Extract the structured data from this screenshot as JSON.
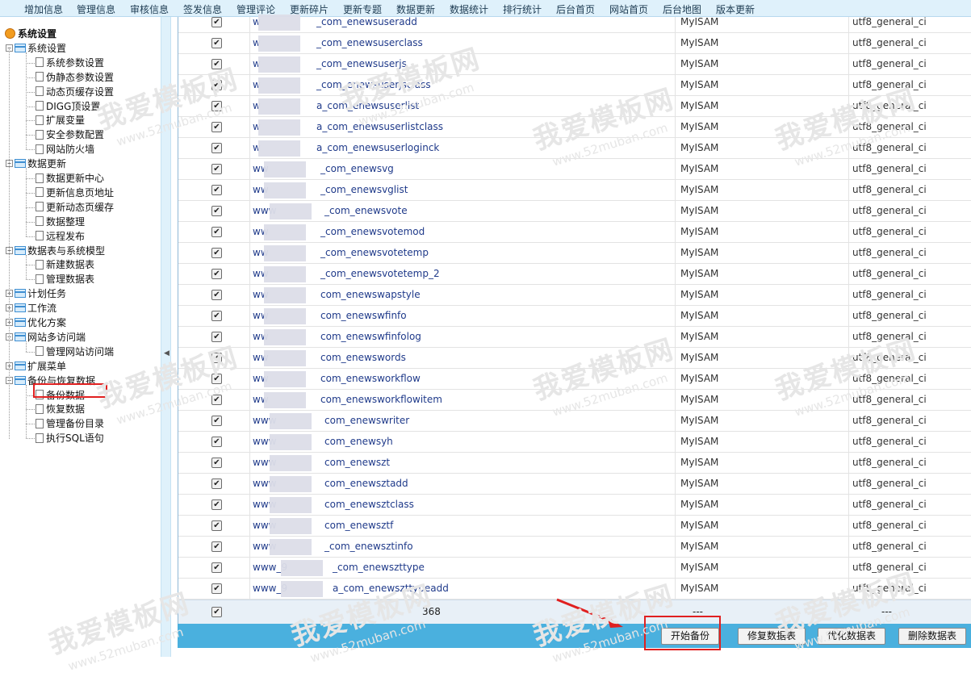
{
  "top_nav": [
    "增加信息",
    "管理信息",
    "审核信息",
    "签发信息",
    "管理评论",
    "更新碎片",
    "更新专题",
    "数据更新",
    "数据统计",
    "排行统计",
    "后台首页",
    "网站首页",
    "后台地图",
    "版本更新"
  ],
  "sidebar": {
    "root": "系统设置",
    "groups": [
      {
        "label": "系统设置",
        "expanded": true,
        "items": [
          "系统参数设置",
          "伪静态参数设置",
          "动态页缓存设置",
          "DIGG顶设置",
          "扩展变量",
          "安全参数配置",
          "网站防火墙"
        ]
      },
      {
        "label": "数据更新",
        "expanded": true,
        "items": [
          "数据更新中心",
          "更新信息页地址",
          "更新动态页缓存",
          "数据整理",
          "远程发布"
        ]
      },
      {
        "label": "数据表与系统模型",
        "expanded": true,
        "items": [
          "新建数据表",
          "管理数据表"
        ]
      },
      {
        "label": "计划任务",
        "expanded": false,
        "items": []
      },
      {
        "label": "工作流",
        "expanded": false,
        "items": []
      },
      {
        "label": "优化方案",
        "expanded": false,
        "items": []
      },
      {
        "label": "网站多访问端",
        "expanded": true,
        "items": [
          "管理网站访问端"
        ]
      },
      {
        "label": "扩展菜单",
        "expanded": false,
        "items": []
      },
      {
        "label": "备份与恢复数据",
        "expanded": true,
        "items": [
          "备份数据",
          "恢复数据",
          "管理备份目录",
          "执行SQL语句"
        ]
      }
    ],
    "selected_item": "备份数据"
  },
  "table": {
    "checked_mark": "✔",
    "rows": [
      {
        "name": "_com_enewsuseradd",
        "prefix": "w",
        "engine": "MyISAM",
        "collation": "utf8_general_ci"
      },
      {
        "name": "_com_enewsuserclass",
        "prefix": "w",
        "engine": "MyISAM",
        "collation": "utf8_general_ci"
      },
      {
        "name": "_com_enewsuserjs",
        "prefix": "w",
        "engine": "MyISAM",
        "collation": "utf8_general_ci"
      },
      {
        "name": "_com_enewsuserjsclass",
        "prefix": "w",
        "engine": "MyISAM",
        "collation": "utf8_general_ci"
      },
      {
        "name": "a_com_enewsuserlist",
        "prefix": "w",
        "engine": "MyISAM",
        "collation": "utf8_general_ci"
      },
      {
        "name": "a_com_enewsuserlistclass",
        "prefix": "w",
        "engine": "MyISAM",
        "collation": "utf8_general_ci"
      },
      {
        "name": "a_com_enewsuserloginck",
        "prefix": "w",
        "engine": "MyISAM",
        "collation": "utf8_general_ci"
      },
      {
        "name": "_com_enewsvg",
        "prefix": "ww",
        "engine": "MyISAM",
        "collation": "utf8_general_ci"
      },
      {
        "name": "_com_enewsvglist",
        "prefix": "ww",
        "engine": "MyISAM",
        "collation": "utf8_general_ci"
      },
      {
        "name": "_com_enewsvote",
        "prefix": "www",
        "engine": "MyISAM",
        "collation": "utf8_general_ci"
      },
      {
        "name": "_com_enewsvotemod",
        "prefix": "ww",
        "engine": "MyISAM",
        "collation": "utf8_general_ci"
      },
      {
        "name": "_com_enewsvotetemp",
        "prefix": "ww",
        "engine": "MyISAM",
        "collation": "utf8_general_ci"
      },
      {
        "name": "_com_enewsvotetemp_2",
        "prefix": "ww",
        "engine": "MyISAM",
        "collation": "utf8_general_ci"
      },
      {
        "name": "com_enewswapstyle",
        "prefix": "ww",
        "engine": "MyISAM",
        "collation": "utf8_general_ci"
      },
      {
        "name": "com_enewswfinfo",
        "prefix": "ww",
        "engine": "MyISAM",
        "collation": "utf8_general_ci"
      },
      {
        "name": "com_enewswfinfolog",
        "prefix": "ww",
        "engine": "MyISAM",
        "collation": "utf8_general_ci"
      },
      {
        "name": "com_enewswords",
        "prefix": "ww",
        "engine": "MyISAM",
        "collation": "utf8_general_ci"
      },
      {
        "name": "com_enewsworkflow",
        "prefix": "ww",
        "engine": "MyISAM",
        "collation": "utf8_general_ci"
      },
      {
        "name": "com_enewsworkflowitem",
        "prefix": "ww",
        "engine": "MyISAM",
        "collation": "utf8_general_ci"
      },
      {
        "name": "com_enewswriter",
        "prefix": "www",
        "engine": "MyISAM",
        "collation": "utf8_general_ci"
      },
      {
        "name": "com_enewsyh",
        "prefix": "www",
        "engine": "MyISAM",
        "collation": "utf8_general_ci"
      },
      {
        "name": "com_enewszt",
        "prefix": "www",
        "engine": "MyISAM",
        "collation": "utf8_general_ci"
      },
      {
        "name": "com_enewsztadd",
        "prefix": "www",
        "engine": "MyISAM",
        "collation": "utf8_general_ci"
      },
      {
        "name": "com_enewsztclass",
        "prefix": "www",
        "engine": "MyISAM",
        "collation": "utf8_general_ci"
      },
      {
        "name": "com_enewsztf",
        "prefix": "www",
        "engine": "MyISAM",
        "collation": "utf8_general_ci"
      },
      {
        "name": "_com_enewsztinfo",
        "prefix": "www",
        "engine": "MyISAM",
        "collation": "utf8_general_ci"
      },
      {
        "name": "_com_enewszttype",
        "prefix": "www_9",
        "engine": "MyISAM",
        "collation": "utf8_general_ci"
      },
      {
        "name": "a_com_enewszttypeadd",
        "prefix": "www_9",
        "engine": "MyISAM",
        "collation": "utf8_general_ci"
      }
    ],
    "summary": {
      "count": "368",
      "engine": "---",
      "collation": "---"
    }
  },
  "actions": {
    "start_backup": "开始备份",
    "repair_tables": "修复数据表",
    "optimize_tables": "优化数据表",
    "delete_tables": "删除数据表"
  },
  "watermark": {
    "text": "我爱模板网",
    "url": "www.52muban.com"
  },
  "colors": {
    "nav_bg": "#dff1fb",
    "action_bar": "#4ab0de",
    "highlight": "#e02020",
    "link": "#1f3a8a"
  }
}
